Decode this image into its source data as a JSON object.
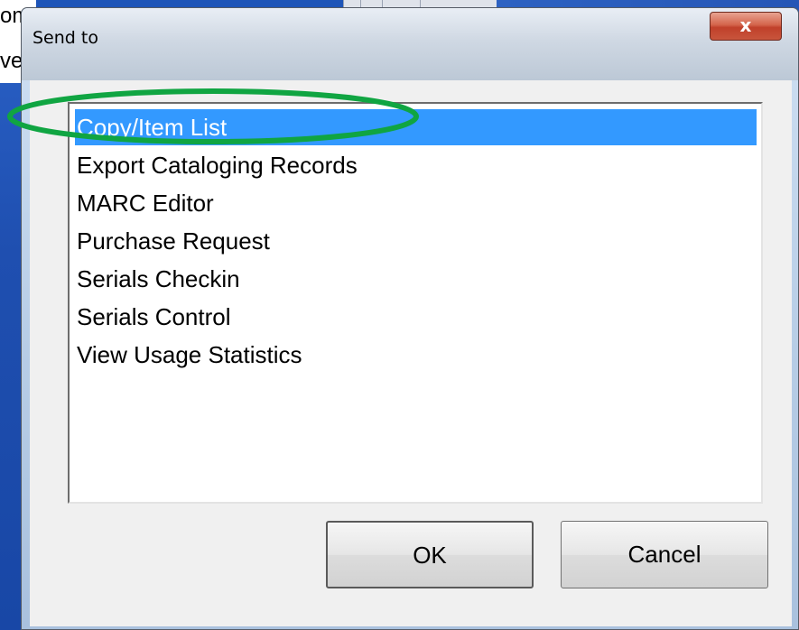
{
  "background": {
    "fragment_1": "om",
    "fragment_2": "ve"
  },
  "dialog": {
    "title": "Send to",
    "close_label": "x"
  },
  "list": {
    "items": [
      {
        "label": "Copy/Item List",
        "selected": true
      },
      {
        "label": "Export Cataloging Records",
        "selected": false
      },
      {
        "label": "MARC Editor",
        "selected": false
      },
      {
        "label": "Purchase Request",
        "selected": false
      },
      {
        "label": "Serials Checkin",
        "selected": false
      },
      {
        "label": "Serials Control",
        "selected": false
      },
      {
        "label": "View Usage Statistics",
        "selected": false
      }
    ]
  },
  "buttons": {
    "ok": "OK",
    "cancel": "Cancel"
  },
  "annotation": {
    "ellipse_color": "#10a542"
  },
  "colors": {
    "selection": "#3399ff",
    "desktop": "#1e55b8"
  }
}
